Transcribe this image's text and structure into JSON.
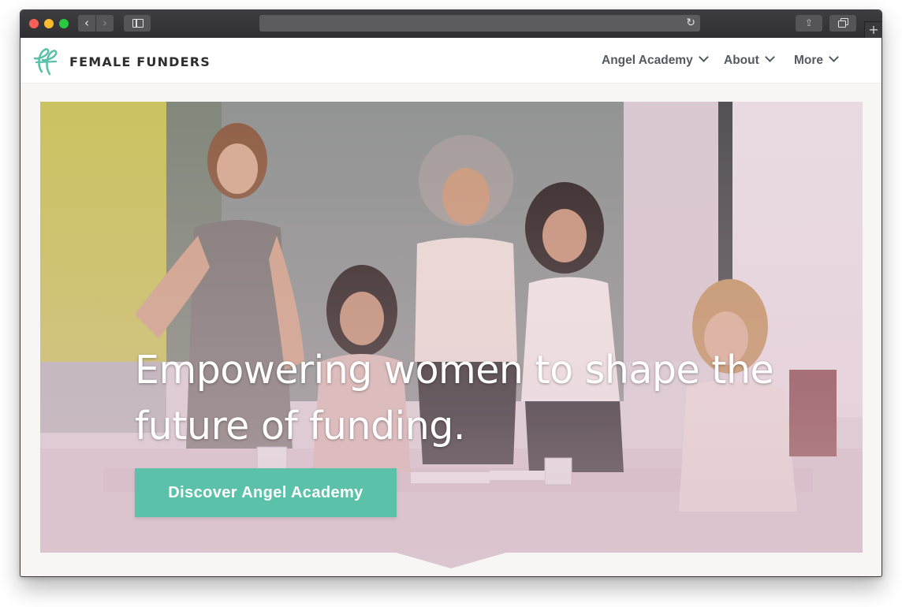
{
  "browser": {
    "back_icon": "chevron-left-icon",
    "forward_icon": "chevron-right-icon",
    "sidebar_icon": "sidebar-icon",
    "reload_glyph": "↻",
    "share_glyph": "⇪",
    "new_tab_glyph": "+"
  },
  "header": {
    "logo_icon": "ff-script-logo-icon",
    "brand": "FEMALE FUNDERS",
    "nav": [
      {
        "label": "Angel Academy",
        "icon": "chevron-down-icon"
      },
      {
        "label": "About",
        "icon": "chevron-down-icon"
      },
      {
        "label": "More",
        "icon": "chevron-down-icon"
      }
    ]
  },
  "hero": {
    "title": "Empowering women to shape the future of funding.",
    "cta_label": "Discover Angel Academy"
  },
  "colors": {
    "accent": "#5bc2a9",
    "tint": "#dcc4cf",
    "brand_text": "#2e2e2e",
    "nav_text": "#555a60"
  }
}
